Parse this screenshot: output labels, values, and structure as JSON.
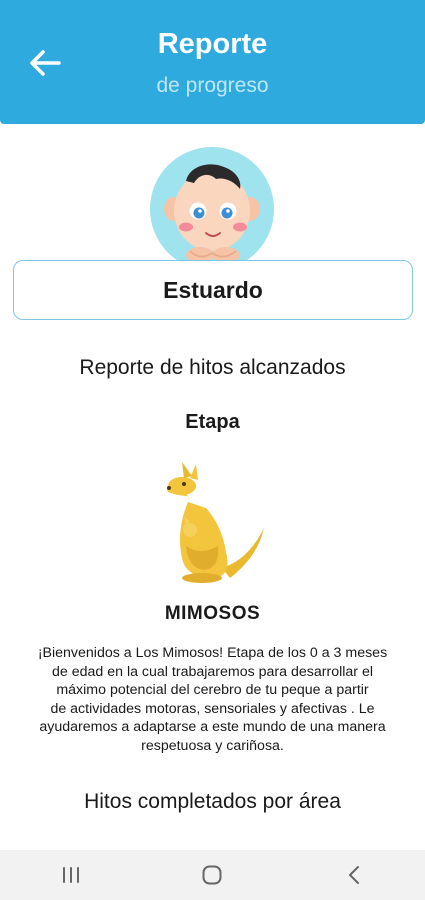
{
  "header": {
    "title": "Reporte",
    "subtitle": "de progreso",
    "back_icon": "arrow-left-icon"
  },
  "child": {
    "avatar_icon": "baby-avatar-icon",
    "name": "Estuardo"
  },
  "report": {
    "heading": "Reporte de hitos alcanzados",
    "stage_label": "Etapa",
    "stage_icon": "kangaroo-icon",
    "stage_name": "MIMOSOS",
    "description_lines": [
      "¡Bienvenidos a Los Mimosos! Etapa de los 0 a 3 meses",
      "de edad en la cual trabajaremos para desarrollar el",
      "máximo potencial del cerebro de tu peque a partir",
      "de actividades motoras, sensoriales y afectivas . Le",
      "ayudaremos a adaptarse a este mundo de una manera",
      "respetuosa y cariñosa."
    ],
    "areas_heading": "Hitos completados por área"
  },
  "system_nav": {
    "recents_icon": "recent-apps-icon",
    "home_icon": "home-icon",
    "back_icon": "back-chevron-icon"
  },
  "colors": {
    "primary": "#2eaadf",
    "avatar_bg": "#9ee3ee",
    "kangaroo": "#f2c53d",
    "name_border": "#7fc7e3"
  }
}
